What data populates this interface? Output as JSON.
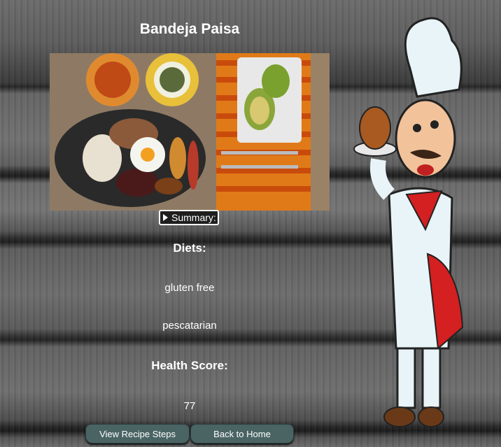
{
  "recipe": {
    "title": "Bandeja Paisa",
    "summary_label": "Summary:",
    "diets_label": "Diets:",
    "diets": [
      "gluten free",
      "pescatarian"
    ],
    "health_label": "Health Score:",
    "health_score": "77"
  },
  "buttons": {
    "steps": "View Recipe Steps",
    "home": "Back to Home"
  }
}
